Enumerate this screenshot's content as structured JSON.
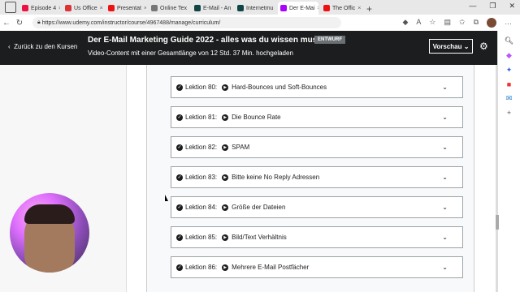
{
  "browser": {
    "tabs": [
      {
        "label": "Episode 4",
        "color": "#e14"
      },
      {
        "label": "Us Office",
        "color": "#d33"
      },
      {
        "label": "Presentat",
        "color": "#e11"
      },
      {
        "label": "Online Tex",
        "color": "#777"
      },
      {
        "label": "E-Mail - An",
        "color": "#144"
      },
      {
        "label": "Internetmu",
        "color": "#144"
      },
      {
        "label": "Der E-Mai",
        "color": "#a0f",
        "active": true
      },
      {
        "label": "The Offic",
        "color": "#e11"
      }
    ],
    "url": "https://www.udemy.com/instructor/course/4967488/manage/curriculum/"
  },
  "header": {
    "back_label": "Zurück zu den Kursen",
    "title": "Der E-Mail Marketing Guide 2022 - alles was du wissen musst",
    "badge": "ENTWURF",
    "subtitle": "Video-Content mit einer Gesamtlänge von 12 Std. 37 Min. hochgeladen",
    "preview_label": "Vorschau"
  },
  "lectures": [
    {
      "label": "Lektion 80:",
      "title": "Hard-Bounces und Soft-Bounces"
    },
    {
      "label": "Lektion 81:",
      "title": "Die Bounce Rate"
    },
    {
      "label": "Lektion 82:",
      "title": "SPAM"
    },
    {
      "label": "Lektion 83:",
      "title": "Bitte keine No Reply Adressen"
    },
    {
      "label": "Lektion 84:",
      "title": "Größe der Dateien"
    },
    {
      "label": "Lektion 85:",
      "title": "Bild/Text Verhältnis"
    },
    {
      "label": "Lektion 86:",
      "title": "Mehrere E-Mail Postfächer"
    }
  ]
}
